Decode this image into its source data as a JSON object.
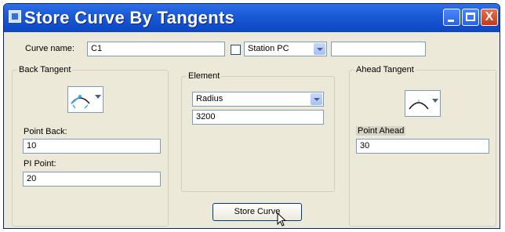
{
  "window": {
    "title": "Store Curve By Tangents",
    "minimize_icon": "minimize-icon",
    "maximize_icon": "maximize-icon",
    "close_icon": "close-icon",
    "close_glyph": "X"
  },
  "curve_name": {
    "label": "Curve name:",
    "value": "C1"
  },
  "station": {
    "checked": false,
    "selected": "Station PC",
    "value": ""
  },
  "back_tangent": {
    "title": "Back Tangent",
    "curve_icon": "curve-tangent-icon",
    "point_back_label": "Point Back:",
    "point_back_value": "10",
    "pi_point_label": "PI Point:",
    "pi_point_value": "20"
  },
  "element": {
    "title": "Element",
    "selected": "Radius",
    "value": "3200"
  },
  "ahead_tangent": {
    "title": "Ahead Tangent",
    "curve_icon": "curve-tangent-icon",
    "point_ahead_label": "Point Ahead",
    "point_ahead_value": "30"
  },
  "store_button": {
    "label": "Store Curve"
  },
  "colors": {
    "title_bar": "#1b5ad6",
    "window_bg": "#ece9d8",
    "close_button": "#c0391b"
  }
}
